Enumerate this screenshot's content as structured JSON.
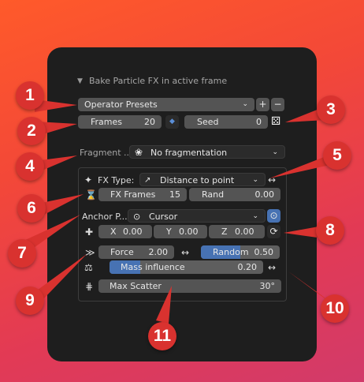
{
  "header": {
    "title": "Bake Particle FX in active frame"
  },
  "operator_presets": {
    "label": "Operator Presets",
    "add": "+",
    "remove": "−"
  },
  "frames": {
    "label": "Frames",
    "value": "20"
  },
  "seed": {
    "label": "Seed",
    "value": "0"
  },
  "fragment": {
    "label": "Fragment ...",
    "value": "No fragmentation"
  },
  "fx_type": {
    "label": "FX Type:",
    "value": "Distance to point"
  },
  "fx_frames": {
    "label": "FX Frames",
    "value": "15"
  },
  "random_top": {
    "label": "Rand",
    "value": "0.00"
  },
  "anchor": {
    "label": "Anchor P...",
    "value": "Cursor"
  },
  "coords": {
    "x_label": "X",
    "x_value": "0.00",
    "y_label": "Y",
    "y_value": "0.00",
    "z_label": "Z",
    "z_value": "0.00"
  },
  "force": {
    "label": "Force",
    "value": "2.00"
  },
  "random_force": {
    "label": "Random",
    "value": "0.50"
  },
  "mass_influence": {
    "label": "Mass influence",
    "value": "0.20"
  },
  "max_scatter": {
    "label": "Max Scatter",
    "value": "30°"
  },
  "callouts": [
    "1",
    "2",
    "3",
    "4",
    "5",
    "6",
    "7",
    "8",
    "9",
    "10",
    "11"
  ],
  "colors": {
    "badge": "#d9322f",
    "accent_blue": "#4772b3",
    "panel": "#1e1e1e"
  }
}
